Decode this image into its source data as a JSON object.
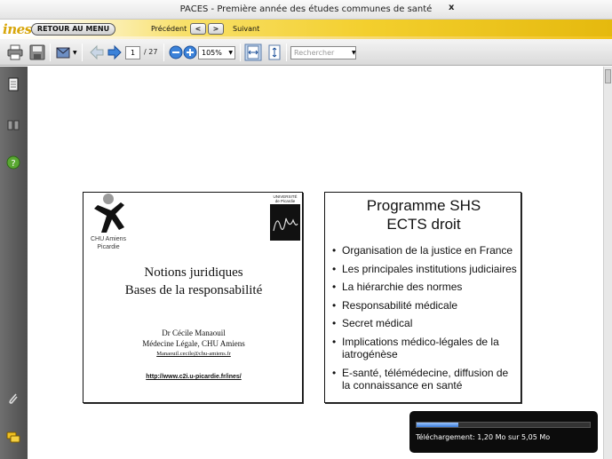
{
  "window": {
    "title": "PACES - Première année des études communes de santé",
    "close": "x"
  },
  "navbar": {
    "logo": "ines",
    "retour": "RETOUR AU MENU",
    "prev_label": "Précédent",
    "prev_btn": "<",
    "next_btn": ">",
    "next_label": "Suivant"
  },
  "toolbar": {
    "page_current": "1",
    "page_total": "/ 27",
    "zoom": "105%",
    "search_placeholder": "Rechercher"
  },
  "slide1": {
    "logo_text": "CHU Amiens\nPicardie",
    "univ_text": "UNIVERSITÉ\nde Picardie",
    "title_line1": "Notions juridiques",
    "title_line2": "Bases de la responsabilité",
    "author": "Dr Cécile Manaouil",
    "affiliation": "Médecine Légale, CHU Amiens",
    "email": "Manaouil.cecile@chu-amiens.fr",
    "url": "http://www.c2i.u-picardie.fr/ines/"
  },
  "slide2": {
    "title_line1": "Programme SHS",
    "title_line2": "ECTS droit",
    "bullets": [
      "Organisation de la justice en France",
      "Les principales institutions judiciaires",
      "La hiérarchie des normes",
      "Responsabilité médicale",
      "Secret médical",
      "Implications médico-légales de la iatrogénèse",
      "E-santé, télémédecine, diffusion de la connaissance en santé"
    ]
  },
  "download": {
    "text": "Téléchargement: 1,20 Mo sur 5,05 Mo",
    "progress": 0.24
  }
}
